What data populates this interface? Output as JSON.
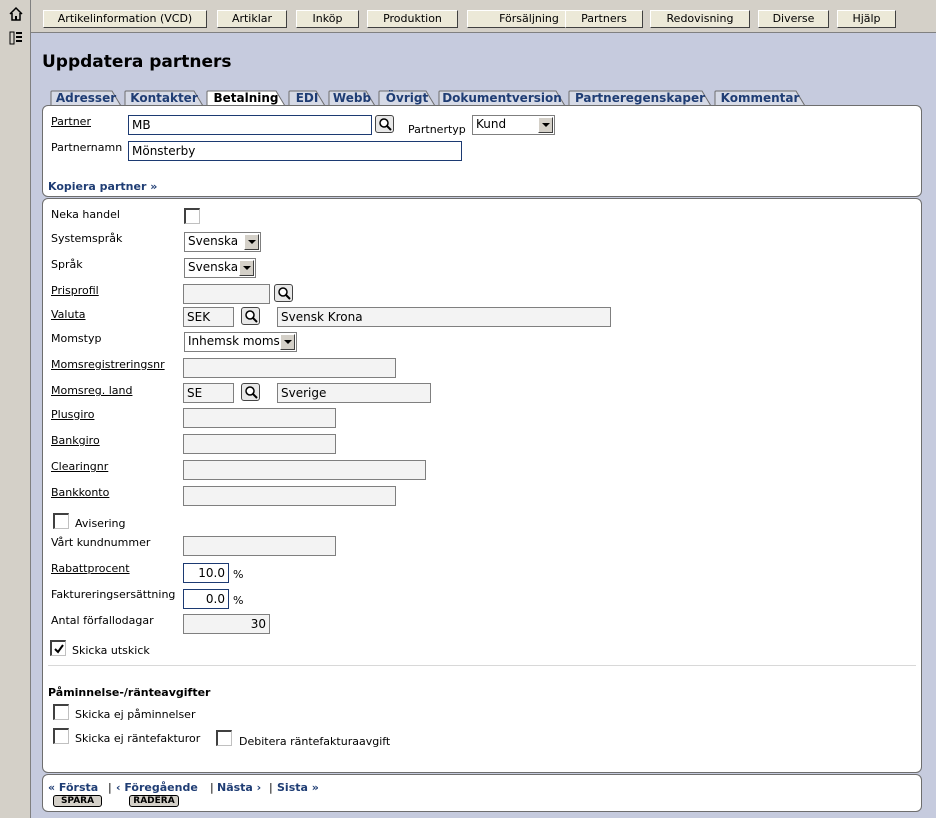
{
  "nav": {
    "items": [
      {
        "label": "Artikelinformation (VCD)"
      },
      {
        "label": "Artiklar"
      },
      {
        "label": "Inköp"
      },
      {
        "label": "Produktion"
      },
      {
        "label": "Försäljning"
      },
      {
        "label": "Partners"
      },
      {
        "label": "Redovisning"
      },
      {
        "label": "Diverse"
      },
      {
        "label": "Hjälp"
      }
    ]
  },
  "left_icons": [
    "home-icon",
    "list-icon"
  ],
  "page_title": "Uppdatera partners",
  "tabs": [
    {
      "label": "Adresser",
      "active": false
    },
    {
      "label": "Kontakter",
      "active": false
    },
    {
      "label": "Betalning",
      "active": true
    },
    {
      "label": "EDI",
      "active": false
    },
    {
      "label": "Webb",
      "active": false
    },
    {
      "label": "Övrigt",
      "active": false
    },
    {
      "label": "Dokumentversion",
      "active": false
    },
    {
      "label": "Partneregenskaper",
      "active": false
    },
    {
      "label": "Kommentar",
      "active": false
    }
  ],
  "partner": {
    "partner_label": "Partner",
    "partner_value": "MB",
    "partnertyp_label": "Partnertyp",
    "partnertyp_value": "Kund",
    "partnernamn_label": "Partnernamn",
    "partnernamn_value": "Mönsterby",
    "copy_link": "Kopiera partner »"
  },
  "form": {
    "neka_handel_label": "Neka handel",
    "neka_handel_checked": false,
    "systemsprak_label": "Systemspråk",
    "systemsprak_value": "Svenska",
    "sprak_label": "Språk",
    "sprak_value": "Svenska",
    "prisprofil_label": "Prisprofil",
    "prisprofil_value": "",
    "valuta_label": "Valuta",
    "valuta_code": "SEK",
    "valuta_name": "Svensk Krona",
    "momstyp_label": "Momstyp",
    "momstyp_value": "Inhemsk moms",
    "momsregnr_label": "Momsregistreringsnr",
    "momsregnr_value": "",
    "momsreg_land_label": "Momsreg. land",
    "momsreg_land_code": "SE",
    "momsreg_land_name": "Sverige",
    "plusgiro_label": "Plusgiro",
    "plusgiro_value": "",
    "bankgiro_label": "Bankgiro",
    "bankgiro_value": "",
    "clearingnr_label": "Clearingnr",
    "clearingnr_value": "",
    "bankkonto_label": "Bankkonto",
    "bankkonto_value": "",
    "avisering_label": "Avisering",
    "avisering_checked": false,
    "vart_kundnummer_label": "Vårt kundnummer",
    "vart_kundnummer_value": "",
    "rabattprocent_label": "Rabattprocent",
    "rabattprocent_value": "10.0",
    "faktureringsersattning_label": "Faktureringsersättning",
    "faktureringsersattning_value": "0.0",
    "percent_sign": "%",
    "antal_forfallodagar_label": "Antal förfallodagar",
    "antal_forfallodagar_value": "30",
    "skicka_utskick_label": "Skicka utskick",
    "skicka_utskick_checked": true
  },
  "reminders": {
    "title": "Påminnelse-/ränteavgifter",
    "skicka_ej_paminnelser_label": "Skicka ej påminnelser",
    "skicka_ej_paminnelser_checked": false,
    "skicka_ej_rantefakturor_label": "Skicka ej räntefakturor",
    "skicka_ej_rantefakturor_checked": false,
    "debitera_label": "Debitera räntefakturaavgift",
    "debitera_checked": false
  },
  "footer": {
    "first": "« Första",
    "prev": "‹ Föregående",
    "next": "Nästa ›",
    "last": "Sista »",
    "sep": "|",
    "save": "SPARA",
    "delete": "RADERA"
  }
}
